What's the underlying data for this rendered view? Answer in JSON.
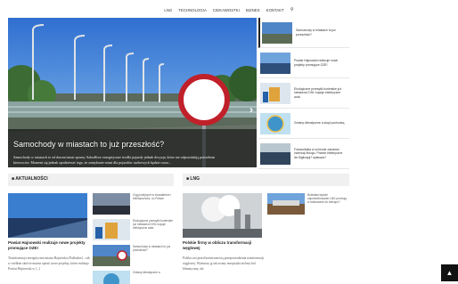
{
  "nav": {
    "items": [
      "LNG",
      "TECHNOLOGIA",
      "CIEKAWOSTKI",
      "BIZNES",
      "KONTAKT"
    ],
    "search_icon": "search-icon"
  },
  "hero": {
    "title": "Samochody w miastach to już przeszłość?",
    "excerpt": "Samochody w miastach to od dawna temat sporny. Szkodliwe energetyczne środki pojazdy jednak decyzja, które nie odpowiadają potrzebom kierowców. Moment się jednak spodziewać tego, że zamykanie miast dla pojazdów osobowych będzie coraz...",
    "next_icon": "chevron-right-icon"
  },
  "sidebar": {
    "items": [
      {
        "text": "Samochody w miastach to już przeszłość?"
      },
      {
        "text": "Powiat Hajnowski realizuje nowe projekty promujące OZE!"
      },
      {
        "text": "Ekologiczne przesyłki kurierskie już niedawno! DHL kupuje elektryczne auta"
      },
      {
        "text": "Zmiany klimatyczne a skąd pochodzą"
      },
      {
        "text": "Fotowoltaika w ochronie zasobów zwierząt Mózgu. Przede elektryczne de-Sigłuwjuj? spłacasz?"
      }
    ]
  },
  "sections": {
    "aktualnosci": {
      "header": "AKTUALNOŚCI",
      "main_title": "Powiat Hajnowski realizuje nowe projekty promujące OZE!",
      "main_excerpt": "Transformacja energetyczna miasta Hajnówka (Podlaskie) – tak w wielkim skrócie można opisać nowe projekty, które realizuje Powiat Hajnowski w [...]",
      "side_items": [
        {
          "text": "Ciąg kolejnych w charakterze i elektryczność, co Polsce"
        },
        {
          "text": "Ekologiczne przesyłki kurierskie już niedawno! DHL kupuje elektryczne auta"
        },
        {
          "text": "Samochody w miastach to już przeszłość?"
        },
        {
          "text": "Zmiany klimatyczne a"
        }
      ]
    },
    "lng": {
      "header": "LNG",
      "main_title": "Polskie firmy w obliczu transformacji węglowej",
      "main_excerpt": "Polska stoi przed koniecznością przeprowadzenia transformacji węglowej. Wymusza ją tak zwany europejski zielony ład klimatyczny, ale",
      "side_items": [
        {
          "text": "Bolesław będzie zapotrzebowanie LNG promują w tankowane do bieżąco?"
        }
      ]
    }
  },
  "back_to_top_icon": "arrow-up-icon"
}
